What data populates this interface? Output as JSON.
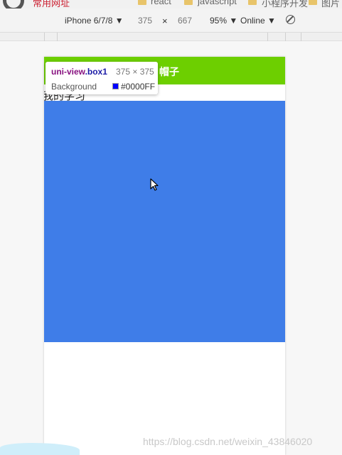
{
  "bookmarks": {
    "item1": "常用网址",
    "item2": "react",
    "item3": "javascript",
    "item4": "小程序开发",
    "item5": "图片"
  },
  "device_toolbar": {
    "device": "iPhone 6/7/8 ▼",
    "width": "375",
    "separator": "×",
    "height": "667",
    "zoom": "95% ▼",
    "network": "Online ▼"
  },
  "navbar": {
    "title": "帽子"
  },
  "body_text": "我的学习",
  "inspector": {
    "tag": "uni-view",
    "class": ".box1",
    "size": "375 × 375",
    "label": "Background",
    "value": "#0000FF"
  },
  "colors": {
    "navbar": "#6dcf00",
    "box1": "#3f7de8",
    "swatch": "#0000FF"
  },
  "watermark": "https://blog.csdn.net/weixin_43846020"
}
